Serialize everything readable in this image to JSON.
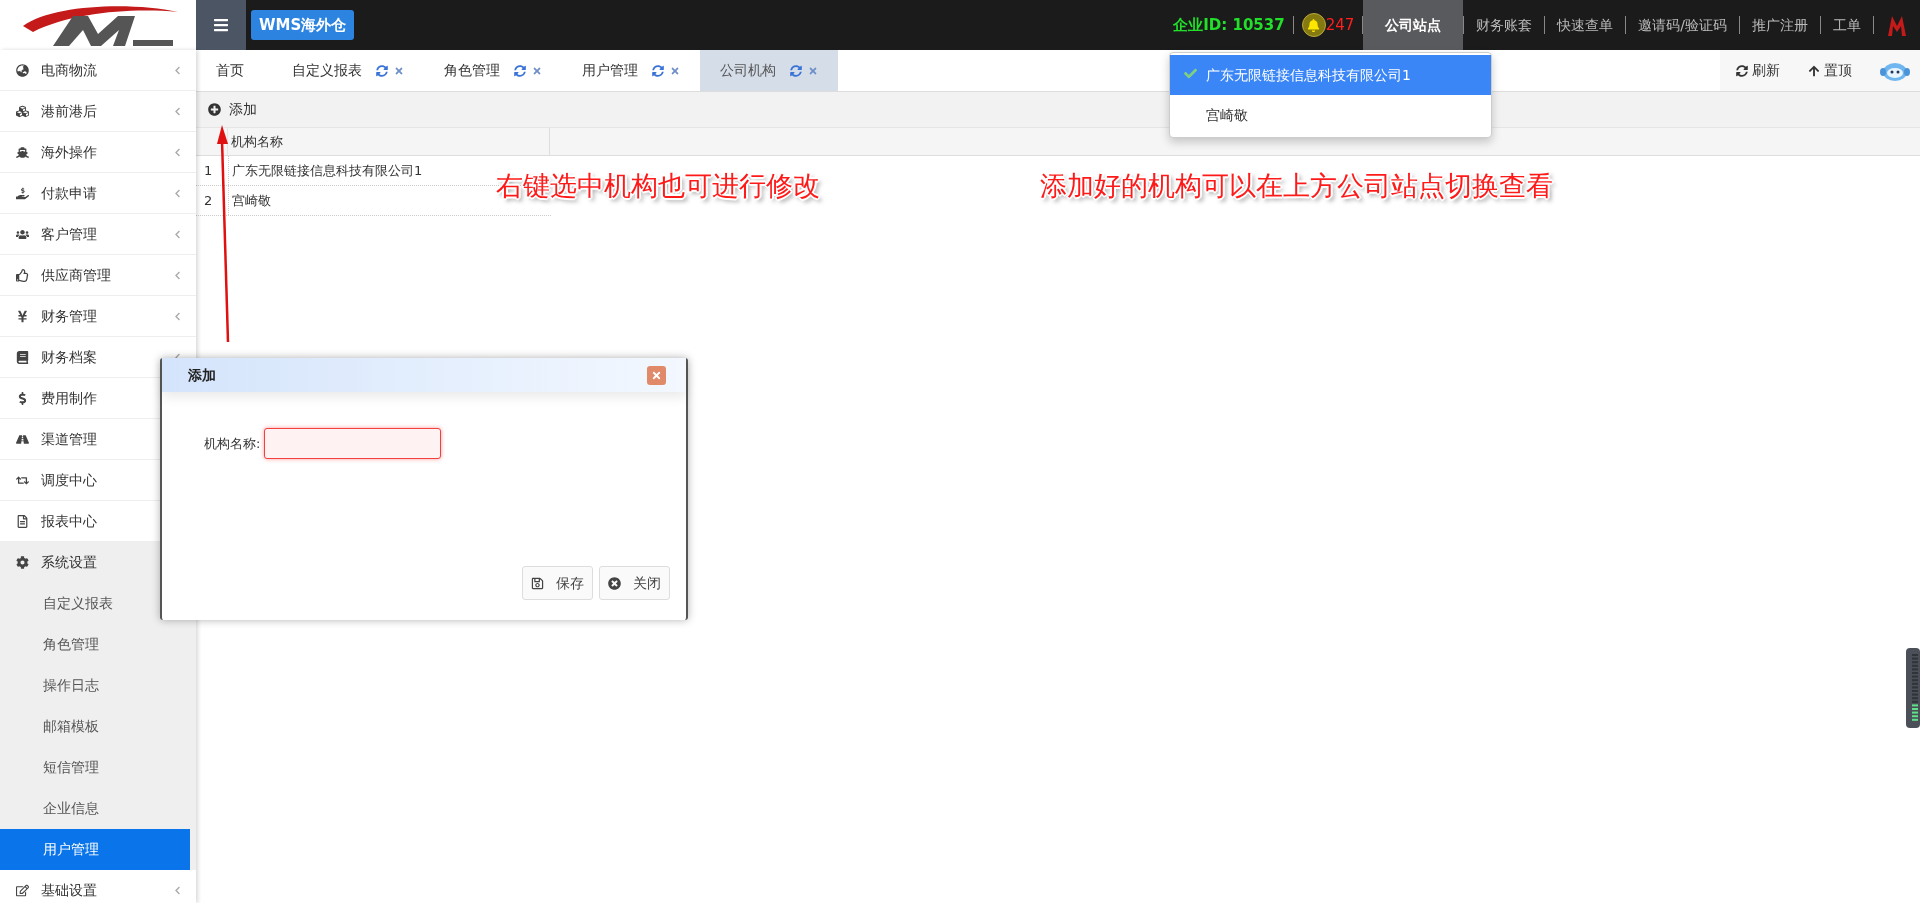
{
  "header": {
    "app_button": "WMS海外仓",
    "company_id": "企业ID: 10537",
    "notifications": "247",
    "nav": [
      {
        "label": "公司站点",
        "selected": true
      },
      {
        "label": "财务账套",
        "selected": false
      },
      {
        "label": "快速查单",
        "selected": false
      },
      {
        "label": "邀请码/验证码",
        "selected": false
      },
      {
        "label": "推广注册",
        "selected": false
      },
      {
        "label": "工单",
        "selected": false
      }
    ]
  },
  "sidebar": {
    "items": [
      {
        "label": "电商物流",
        "expanded": false
      },
      {
        "label": "港前港后",
        "expanded": false
      },
      {
        "label": "海外操作",
        "expanded": false
      },
      {
        "label": "付款申请",
        "expanded": false
      },
      {
        "label": "客户管理",
        "expanded": false
      },
      {
        "label": "供应商管理",
        "expanded": false
      },
      {
        "label": "财务管理",
        "expanded": false
      },
      {
        "label": "财务档案",
        "expanded": false
      },
      {
        "label": "费用制作",
        "expanded": false
      },
      {
        "label": "渠道管理",
        "expanded": false
      },
      {
        "label": "调度中心",
        "expanded": false
      },
      {
        "label": "报表中心",
        "expanded": false
      },
      {
        "label": "系统设置",
        "expanded": true,
        "children": [
          {
            "label": "自定义报表",
            "selected": false
          },
          {
            "label": "角色管理",
            "selected": false
          },
          {
            "label": "操作日志",
            "selected": false
          },
          {
            "label": "邮箱模板",
            "selected": false
          },
          {
            "label": "短信管理",
            "selected": false
          },
          {
            "label": "企业信息",
            "selected": false
          },
          {
            "label": "用户管理",
            "selected": true
          }
        ]
      },
      {
        "label": "基础设置",
        "expanded": false
      }
    ]
  },
  "tabs": [
    {
      "label": "首页",
      "kind": "home",
      "selected": false
    },
    {
      "label": "自定义报表",
      "kind": "page",
      "selected": false
    },
    {
      "label": "角色管理",
      "kind": "page",
      "selected": false
    },
    {
      "label": "用户管理",
      "kind": "page",
      "selected": false
    },
    {
      "label": "公司机构",
      "kind": "page",
      "selected": true
    }
  ],
  "tab_actions": [
    "刷新",
    "置顶"
  ],
  "toolbar": {
    "add_button": "添加"
  },
  "table": {
    "columns": [
      "机构名称"
    ],
    "rows": [
      {
        "index": "1",
        "name": "广东无限链接信息科技有限公司1"
      },
      {
        "index": "2",
        "name": "宫崎敬"
      }
    ]
  },
  "site_dropdown": {
    "items": [
      {
        "label": "广东无限链接信息科技有限公司1",
        "selected": true
      },
      {
        "label": "宫崎敬",
        "selected": false
      }
    ]
  },
  "annotations": [
    "右键选中机构也可进行修改",
    "添加好的机构可以在上方公司站点切换查看"
  ],
  "dialog": {
    "title": "添加",
    "field_label": "机构名称:",
    "field_invalid": true,
    "buttons": [
      {
        "label": "保存"
      },
      {
        "label": "关闭"
      }
    ]
  }
}
